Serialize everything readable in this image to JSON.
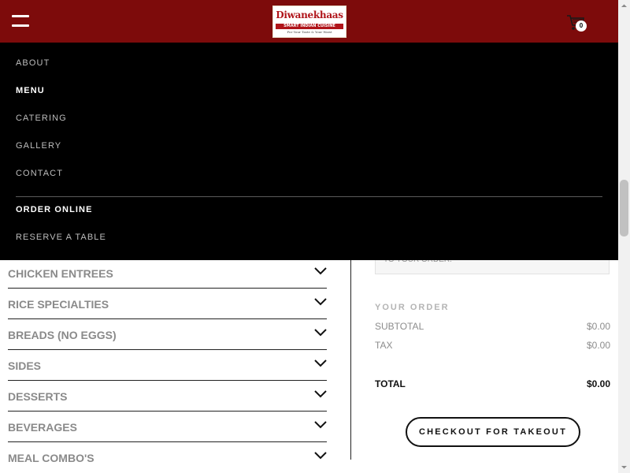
{
  "header": {
    "logo": {
      "name": "Diwanekhaas",
      "band": "SMART INDIAN CUISINE",
      "tagline": "For Your Taste & Your Waist"
    },
    "cart_count": "0",
    "colors": {
      "header_bg": "#7d0b0b",
      "nav_bg": "#000000"
    }
  },
  "nav": {
    "items": [
      {
        "label": "ABOUT"
      },
      {
        "label": "MENU"
      },
      {
        "label": "CATERING"
      },
      {
        "label": "GALLERY"
      },
      {
        "label": "CONTACT"
      },
      {
        "label": "ORDER ONLINE"
      },
      {
        "label": "RESERVE A TABLE"
      }
    ]
  },
  "menu": {
    "categories": [
      {
        "label": "CHICKEN ENTREES"
      },
      {
        "label": "RICE SPECIALTIES"
      },
      {
        "label": "BREADS (NO EGGS)"
      },
      {
        "label": "SIDES"
      },
      {
        "label": "DESSERTS"
      },
      {
        "label": "BEVERAGES"
      },
      {
        "label": "MEAL COMBO'S"
      }
    ]
  },
  "order": {
    "note_partial": "TO YOUR ORDER.",
    "title": "YOUR ORDER",
    "subtotal_label": "SUBTOTAL",
    "subtotal_value": "$0.00",
    "tax_label": "TAX",
    "tax_value": "$0.00",
    "total_label": "TOTAL",
    "total_value": "$0.00",
    "checkout_label": "CHECKOUT FOR TAKEOUT"
  }
}
